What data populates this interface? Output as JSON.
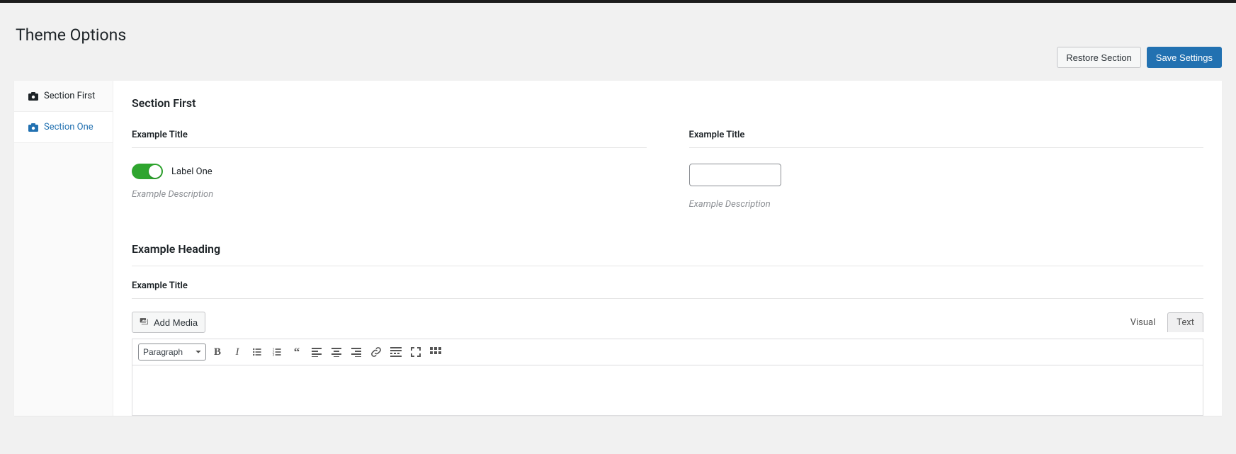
{
  "header": {
    "title": "Theme Options",
    "restore_label": "Restore Section",
    "save_label": "Save Settings"
  },
  "sidebar": {
    "items": [
      {
        "label": "Section First",
        "active": false
      },
      {
        "label": "Section One",
        "active": true
      }
    ]
  },
  "content": {
    "section_title": "Section First",
    "field_toggle": {
      "title": "Example Title",
      "label": "Label One",
      "description": "Example Description"
    },
    "field_text": {
      "title": "Example Title",
      "value": "",
      "description": "Example Description"
    },
    "heading": "Example Heading",
    "editor": {
      "title": "Example Title",
      "add_media_label": "Add Media",
      "tabs": {
        "visual": "Visual",
        "text": "Text"
      },
      "format_select": "Paragraph"
    }
  }
}
